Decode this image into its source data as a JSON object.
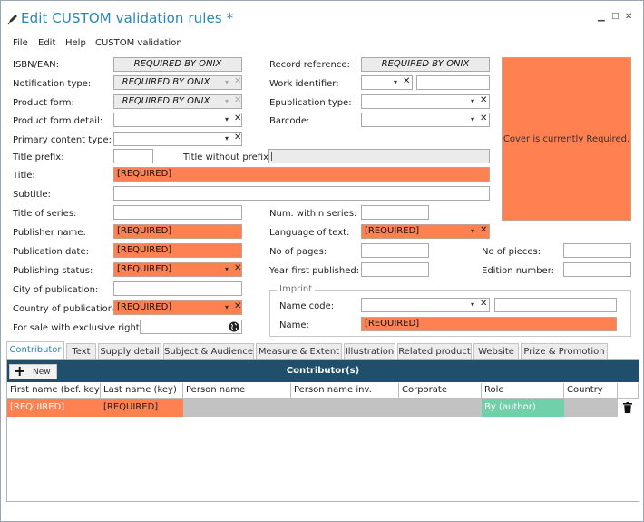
{
  "window": {
    "title": "Edit CUSTOM validation rules *"
  },
  "menu": [
    "File",
    "Edit",
    "Help",
    "CUSTOM validation"
  ],
  "fields": {
    "isbn": {
      "label": "ISBN/EAN:",
      "value": "REQUIRED BY ONIX"
    },
    "notification_type": {
      "label": "Notification type:",
      "value": "REQUIRED BY ONIX"
    },
    "product_form": {
      "label": "Product form:",
      "value": "REQUIRED BY ONIX"
    },
    "product_form_detail": {
      "label": "Product form detail:",
      "value": ""
    },
    "primary_content_type": {
      "label": "Primary content type:",
      "value": ""
    },
    "title_prefix": {
      "label": "Title prefix:",
      "value": ""
    },
    "title_without_prefix": {
      "label": "Title without prefix:",
      "value": ""
    },
    "title": {
      "label": "Title:",
      "value": "[REQUIRED]"
    },
    "subtitle": {
      "label": "Subtitle:",
      "value": ""
    },
    "title_of_series": {
      "label": "Title of series:",
      "value": ""
    },
    "publisher_name": {
      "label": "Publisher name:",
      "value": "[REQUIRED]"
    },
    "publication_date": {
      "label": "Publication date:",
      "value": "[REQUIRED]"
    },
    "publishing_status": {
      "label": "Publishing status:",
      "value": "[REQUIRED]"
    },
    "city_of_publication": {
      "label": "City of publication:",
      "value": ""
    },
    "country_of_publication": {
      "label": "Country of publication:",
      "value": "[REQUIRED]"
    },
    "for_sale_exclusive": {
      "label": "For sale with exclusive rights:",
      "value": ""
    },
    "record_reference": {
      "label": "Record reference:",
      "value": "REQUIRED BY ONIX"
    },
    "work_identifier": {
      "label": "Work identifier:",
      "value": ""
    },
    "epublication_type": {
      "label": "Epublication type:",
      "value": ""
    },
    "barcode": {
      "label": "Barcode:",
      "value": ""
    },
    "num_within_series": {
      "label": "Num. within series:",
      "value": ""
    },
    "language_of_text": {
      "label": "Language of text:",
      "value": "[REQUIRED]"
    },
    "no_of_pages": {
      "label": "No of pages:",
      "value": ""
    },
    "year_first_published": {
      "label": "Year first published:",
      "value": ""
    },
    "no_of_pieces": {
      "label": "No of pieces:",
      "value": ""
    },
    "edition_number": {
      "label": "Edition number:",
      "value": ""
    }
  },
  "cover": {
    "text": "Cover is currently Required."
  },
  "imprint": {
    "legend": "Imprint",
    "name_code_label": "Name code:",
    "name_label": "Name:",
    "name_value": "[REQUIRED]"
  },
  "tabs": [
    "Contributor",
    "Text",
    "Supply detail",
    "Subject & Audience",
    "Measure & Extent",
    "Illustration",
    "Related product",
    "Website",
    "Prize & Promotion"
  ],
  "contributor": {
    "new_label": "New",
    "title": "Contributor(s)",
    "columns": [
      "First name (bef. key)",
      "Last name (key)",
      "Person name",
      "Person name inv.",
      "Corporate",
      "Role",
      "Country"
    ],
    "row": [
      "[REQUIRED]",
      "[REQUIRED]",
      "",
      "",
      "",
      "By (author)",
      ""
    ]
  },
  "colors": {
    "required": "#ff8050",
    "role": "#6fd0a9",
    "header": "#1f4f6b",
    "title": "#2a86b6"
  }
}
